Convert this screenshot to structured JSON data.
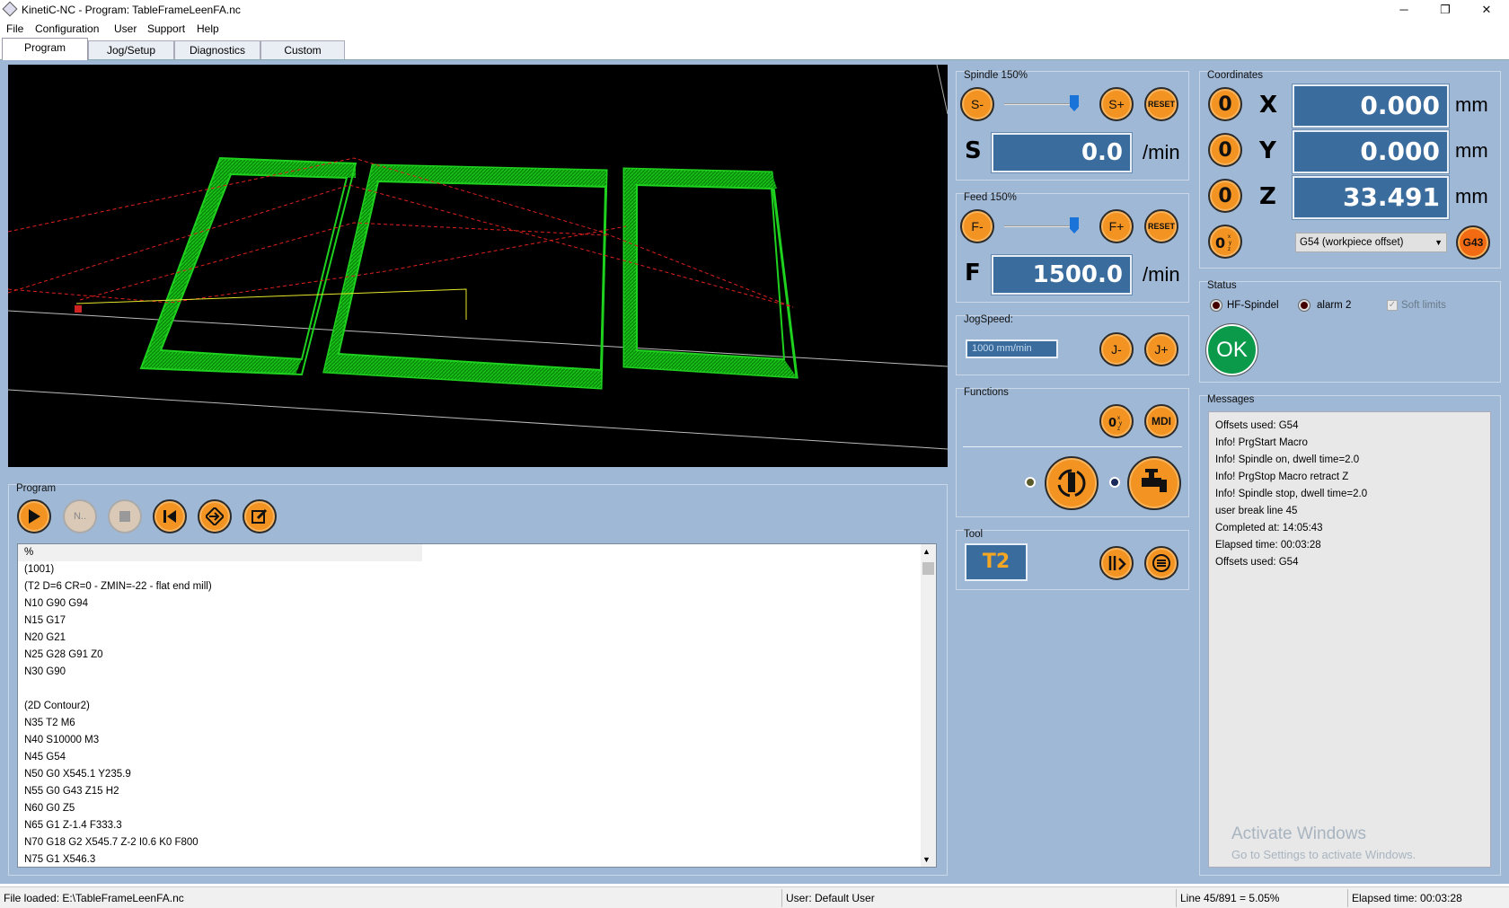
{
  "window": {
    "title": "KinetiC-NC - Program: TableFrameLeenFA.nc",
    "minimize": "─",
    "restore": "❐",
    "close": "✕"
  },
  "menu": [
    "File",
    "Configuration",
    "User",
    "Support",
    "Help"
  ],
  "tabs": [
    "Program",
    "Jog/Setup",
    "Diagnostics",
    "Custom"
  ],
  "spindle": {
    "label": "Spindle 150%",
    "minus": "S-",
    "plus": "S+",
    "reset": "RESET",
    "letter": "S",
    "value": "0.0",
    "unit": "/min",
    "override_percent": 150
  },
  "feed": {
    "label": "Feed 150%",
    "minus": "F-",
    "plus": "F+",
    "reset": "RESET",
    "letter": "F",
    "value": "1500.0",
    "unit": "/min",
    "override_percent": 150
  },
  "jog": {
    "label": "JogSpeed:",
    "value": "1000 mm/min",
    "minus": "J-",
    "plus": "J+"
  },
  "functions": {
    "label": "Functions",
    "mdi": "MDI"
  },
  "tool": {
    "label": "Tool",
    "value": "T2"
  },
  "coordinates": {
    "label": "Coordinates",
    "axes": [
      {
        "name": "X",
        "value": "0.000",
        "unit": "mm",
        "zero": "0"
      },
      {
        "name": "Y",
        "value": "0.000",
        "unit": "mm",
        "zero": "0"
      },
      {
        "name": "Z",
        "value": "33.491",
        "unit": "mm",
        "zero": "0"
      }
    ],
    "offset": "G54 (workpiece offset)",
    "g43": "G43"
  },
  "status": {
    "label": "Status",
    "items": [
      "HF-Spindel",
      "alarm 2",
      "Soft limits"
    ],
    "ok": "OK"
  },
  "messages": {
    "label": "Messages",
    "lines": [
      "Offsets used: G54",
      "Info! PrgStart Macro",
      "Info! Spindle on, dwell time=2.0",
      "Info! PrgStop Macro retract Z",
      "Info! Spindle stop, dwell time=2.0",
      "user break line 45",
      "Completed at: 14:05:43",
      "Elapsed time: 00:03:28",
      "Offsets used: G54"
    ],
    "watermark_title": "Activate Windows",
    "watermark_sub": "Go to Settings to activate Windows."
  },
  "program": {
    "label": "Program",
    "lines": [
      "%",
      "(1001)",
      "(T2 D=6 CR=0 - ZMIN=-22 - flat end mill)",
      "N10 G90 G94",
      "N15 G17",
      "N20 G21",
      "N25 G28 G91 Z0",
      "N30 G90",
      "",
      "(2D Contour2)",
      "N35 T2 M6",
      "N40 S10000 M3",
      "N45 G54",
      "N50 G0 X545.1 Y235.9",
      "N55 G0 G43 Z15 H2",
      "N60 G0 Z5",
      "N65 G1 Z-1.4 F333.3",
      "N70 G18 G2 X545.7 Z-2 I0.6 K0 F800",
      "N75 G1 X546.3"
    ],
    "next_label": "N.."
  },
  "statusbar": {
    "file": "File loaded: E:\\TableFrameLeenFA.nc",
    "user": "User: Default User",
    "line": "Line 45/891 = 5.05%",
    "elapsed": "Elapsed time: 00:03:28"
  }
}
